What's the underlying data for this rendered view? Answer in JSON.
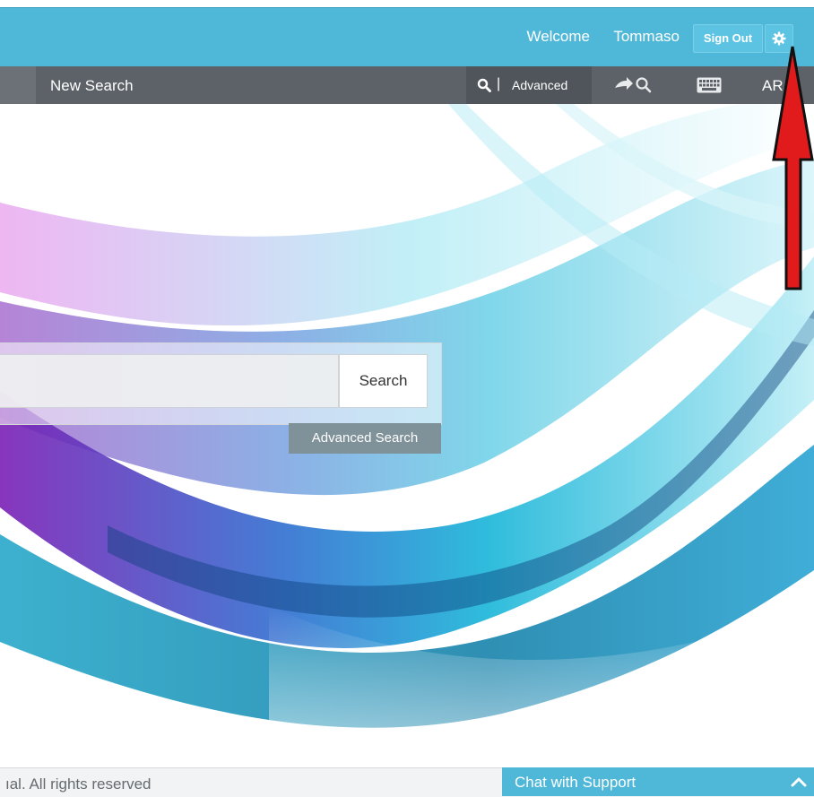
{
  "header": {
    "welcome_text": "Welcome",
    "username": "Tommaso",
    "signout_label": "Sign Out",
    "settings_icon": "gear-icon"
  },
  "nav": {
    "new_search_label": "New Search",
    "search_icon": "search-icon",
    "separator": "|",
    "advanced_label": "Advanced",
    "forward_search_icon": "arrow-search-icon",
    "keyboard_icon": "keyboard-icon",
    "language_label": "AR"
  },
  "search": {
    "input_value": "",
    "button_label": "Search",
    "advanced_button_label": "Advanced Search"
  },
  "footer": {
    "copyright_text": "ıal. All rights reserved",
    "chat_label": "Chat with Support",
    "chat_icon": "chevron-up-icon"
  },
  "colors": {
    "header_bg": "#4fb8d9",
    "nav_bg": "#5d6268",
    "advanced_search_bg": "#7f9199",
    "annotation_arrow": "#e11b1b"
  }
}
